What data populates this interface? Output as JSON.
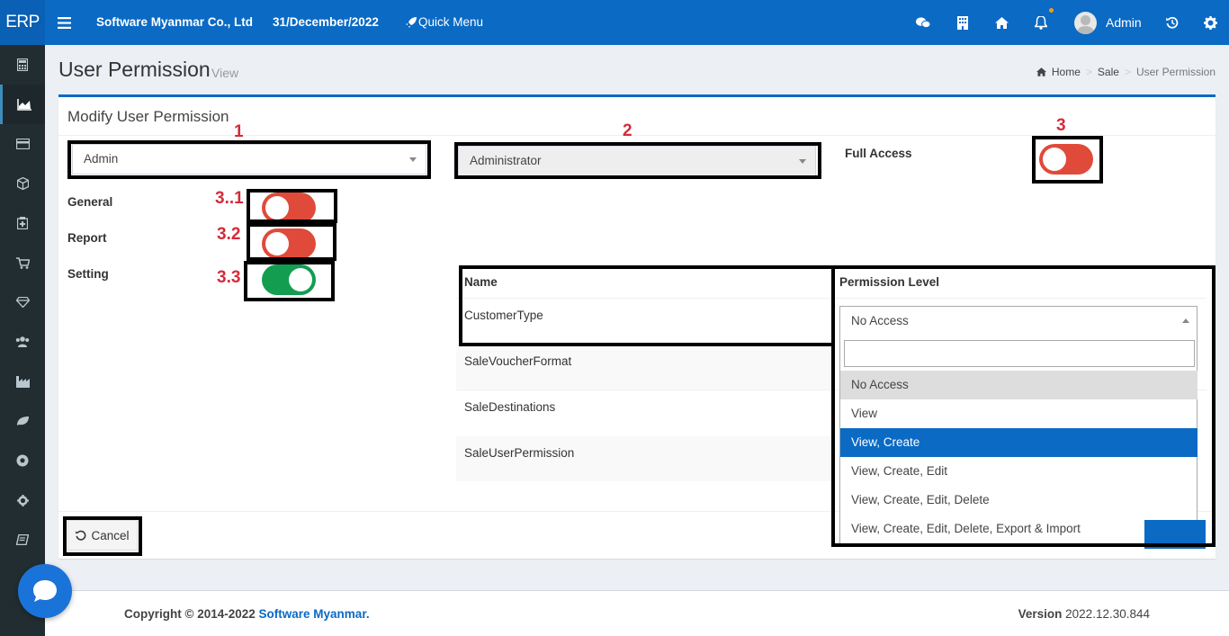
{
  "topbar": {
    "logo": "ERP",
    "company": "Software Myanmar Co., Ltd",
    "date": "31/December/2022",
    "quick_menu": "Quick Menu",
    "user": "Admin"
  },
  "header": {
    "title": "User Permission",
    "subtitle": "View",
    "breadcrumb": [
      "Home",
      "Sale",
      "User Permission"
    ]
  },
  "form": {
    "title": "Modify User Permission",
    "user_select": "Admin",
    "role_select": "Administrator",
    "full_access_label": "Full Access",
    "toggles": [
      {
        "label": "General",
        "state": "off"
      },
      {
        "label": "Report",
        "state": "off"
      },
      {
        "label": "Setting",
        "state": "on"
      }
    ],
    "full_access_state": "off"
  },
  "annotations": {
    "a1": "1",
    "a2": "2",
    "a3": "3",
    "a31": "3..1",
    "a32": "3.2",
    "a33": "3.3"
  },
  "table": {
    "headers": [
      "Name",
      "Permission Level"
    ],
    "rows": [
      "CustomerType",
      "SaleVoucherFormat",
      "SaleDestinations",
      "SaleUserPermission"
    ]
  },
  "dropdown": {
    "current": "No Access",
    "search_value": "",
    "options": [
      "No Access",
      "View",
      "View, Create",
      "View, Create, Edit",
      "View, Create, Edit, Delete",
      "View, Create, Edit, Delete, Export & Import"
    ],
    "highlighted_index": 0,
    "selected_index": 2
  },
  "buttons": {
    "cancel": "Cancel"
  },
  "footer": {
    "copyright": "Copyright © 2014-2022",
    "company_link": "Software Myanmar.",
    "version_label": "Version",
    "version_value": "2022.12.30.844"
  },
  "colors": {
    "primary": "#0a6ac4",
    "toggle_off": "#e04a3a",
    "toggle_on": "#129d51",
    "annotation": "#d52b3a"
  }
}
